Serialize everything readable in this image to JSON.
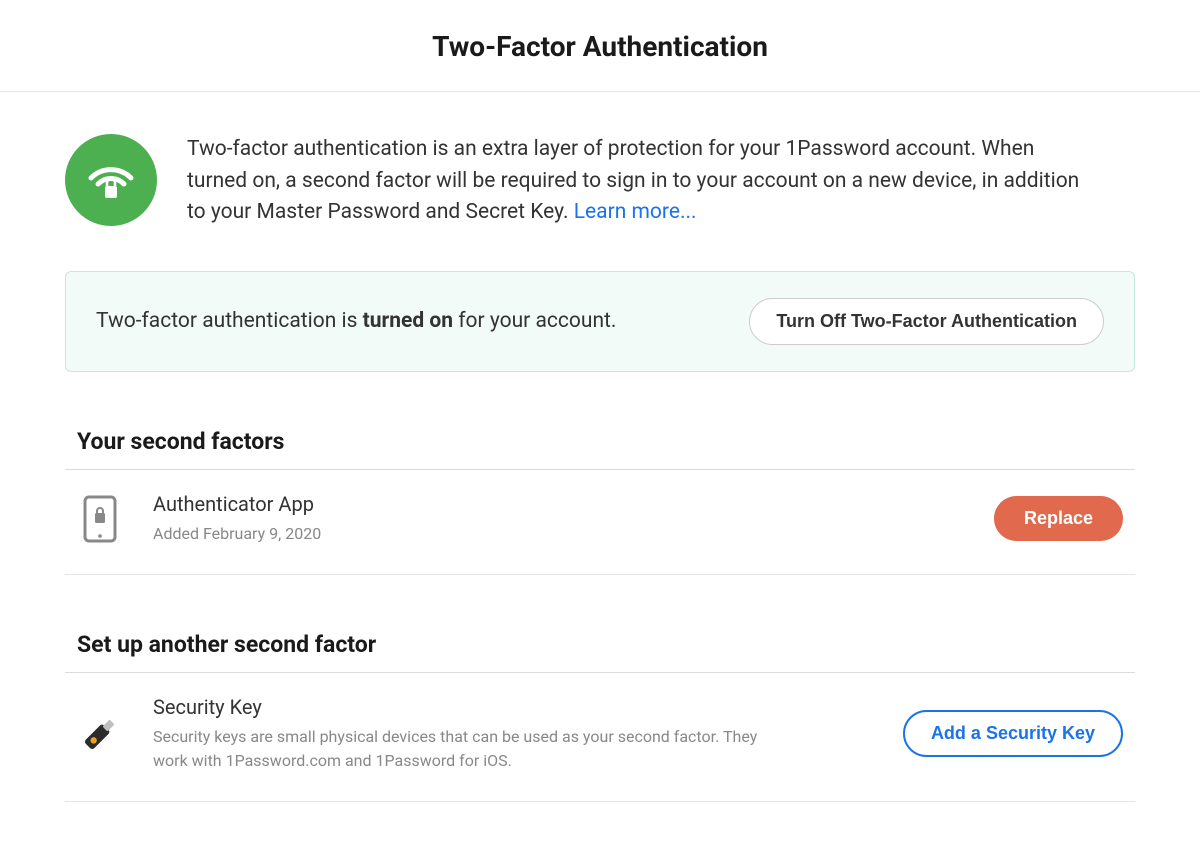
{
  "page": {
    "title": "Two-Factor Authentication"
  },
  "intro": {
    "description_before_link": "Two-factor authentication is an extra layer of protection for your 1Password account. When turned on, a second factor will be required to sign in to your account on a new device, in addition to your Master Password and Secret Key. ",
    "learn_more": "Learn more..."
  },
  "status": {
    "prefix": "Two-factor authentication is ",
    "state": "turned on",
    "suffix": " for your account.",
    "turnoff_label": "Turn Off Two-Factor Authentication"
  },
  "sections": {
    "your_factors_heading": "Your second factors",
    "setup_heading": "Set up another second factor"
  },
  "factors": {
    "authenticator": {
      "title": "Authenticator App",
      "sub": "Added February 9, 2020",
      "action_label": "Replace"
    },
    "security_key": {
      "title": "Security Key",
      "sub": "Security keys are small physical devices that can be used as your second factor. They work with 1Password.com and 1Password for iOS.",
      "action_label": "Add a Security Key"
    }
  },
  "colors": {
    "accent_green": "#4CAF50",
    "accent_blue": "#1a73e8",
    "accent_orange": "#E0694E"
  }
}
